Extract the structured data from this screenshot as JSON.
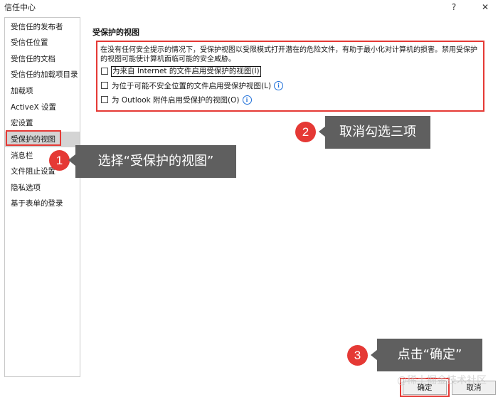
{
  "window": {
    "title": "信任中心",
    "help_glyph": "?",
    "close_glyph": "✕"
  },
  "sidebar": {
    "items": [
      {
        "label": "受信任的发布者"
      },
      {
        "label": "受信任位置"
      },
      {
        "label": "受信任的文档"
      },
      {
        "label": "受信任的加载项目录"
      },
      {
        "label": "加载项"
      },
      {
        "label": "ActiveX 设置"
      },
      {
        "label": "宏设置"
      },
      {
        "label": "受保护的视图"
      },
      {
        "label": "消息栏"
      },
      {
        "label": "文件阻止设置"
      },
      {
        "label": "隐私选项"
      },
      {
        "label": "基于表单的登录"
      }
    ],
    "selected_index": 7
  },
  "main": {
    "title": "受保护的视图",
    "description": "在没有任何安全提示的情况下，受保护视图以受限模式打开潜在的危险文件，有助于最小化对计算机的损害。禁用受保护的视图可能使计算机面临可能的安全威胁。",
    "checkboxes": [
      {
        "label": "为来自 Internet 的文件启用受保护的视图(I)",
        "checked": false
      },
      {
        "label": "为位于可能不安全位置的文件启用受保护视图(L)",
        "checked": false
      },
      {
        "label": "为 Outlook 附件启用受保护的视图(O)",
        "checked": false
      }
    ],
    "info_glyph": "i"
  },
  "buttons": {
    "ok": "确定",
    "cancel": "取消"
  },
  "annotations": [
    {
      "number": "1",
      "text": "选择“受保护的视图”"
    },
    {
      "number": "2",
      "text": "取消勾选三项"
    },
    {
      "number": "3",
      "text": "点击“确定”"
    }
  ],
  "watermark": "@稀土掘金技术社区",
  "colors": {
    "annotation_red": "#e53935",
    "callout_gray": "#5f5f5f",
    "selected_bg": "#d4d4d4",
    "info_blue": "#1e6fd9"
  }
}
